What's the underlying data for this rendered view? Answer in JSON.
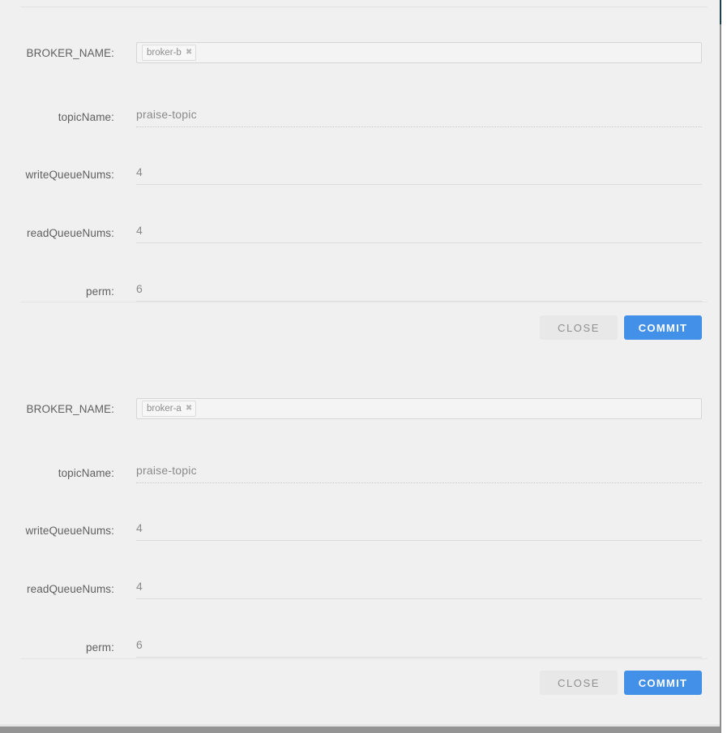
{
  "theme": {
    "page_background": "#f0f0f0",
    "commit_button_color": "#4290e8",
    "commit_button_text_color": "#ffffff",
    "close_button_color": "#e8e8e8",
    "close_button_text_color": "#8f8f8f",
    "label_text_color": "#5f5f5f",
    "value_text_color": "#8a8a8a",
    "tag_border_color": "#dcdcdc",
    "edge_rule_color": "#1d3f4a",
    "bottom_bar_color": "#949494"
  },
  "forms": [
    {
      "id": "broker-b-topic-form",
      "fields": [
        {
          "key": "broker_name",
          "label": "BROKER_NAME:",
          "type": "tags",
          "tags": [
            {
              "label": "broker-b",
              "close_icon": "close-x-icon"
            }
          ]
        },
        {
          "key": "topic_name",
          "label": "topicName:",
          "type": "text",
          "value": "praise-topic",
          "placeholder": "",
          "disabled": true
        },
        {
          "key": "write_queue_nums",
          "label": "writeQueueNums:",
          "type": "text",
          "value": "4",
          "placeholder": "",
          "disabled": false
        },
        {
          "key": "read_queue_nums",
          "label": "readQueueNums:",
          "type": "text",
          "value": "4",
          "placeholder": "",
          "disabled": false
        },
        {
          "key": "perm",
          "label": "perm:",
          "type": "text",
          "value": "6",
          "placeholder": "",
          "disabled": false
        }
      ],
      "actions": {
        "close_label": "CLOSE",
        "commit_label": "COMMIT"
      }
    },
    {
      "id": "broker-a-topic-form",
      "fields": [
        {
          "key": "broker_name",
          "label": "BROKER_NAME:",
          "type": "tags",
          "tags": [
            {
              "label": "broker-a",
              "close_icon": "close-x-icon"
            }
          ]
        },
        {
          "key": "topic_name",
          "label": "topicName:",
          "type": "text",
          "value": "praise-topic",
          "placeholder": "",
          "disabled": true
        },
        {
          "key": "write_queue_nums",
          "label": "writeQueueNums:",
          "type": "text",
          "value": "4",
          "placeholder": "",
          "disabled": false
        },
        {
          "key": "read_queue_nums",
          "label": "readQueueNums:",
          "type": "text",
          "value": "4",
          "placeholder": "",
          "disabled": false
        },
        {
          "key": "perm",
          "label": "perm:",
          "type": "text",
          "value": "6",
          "placeholder": "",
          "disabled": false
        }
      ],
      "actions": {
        "close_label": "CLOSE",
        "commit_label": "COMMIT"
      }
    }
  ],
  "layout": {
    "form_tops": [
      22,
      461
    ],
    "field_row_tops": [
      [
        22,
        105,
        176,
        248,
        320
      ],
      [
        461,
        544,
        615,
        687,
        759
      ]
    ],
    "divider_tops": [
      372,
      812
    ],
    "actions_tops": [
      389,
      827
    ],
    "tagbox_row_height": 56,
    "text_row_height": 52
  }
}
